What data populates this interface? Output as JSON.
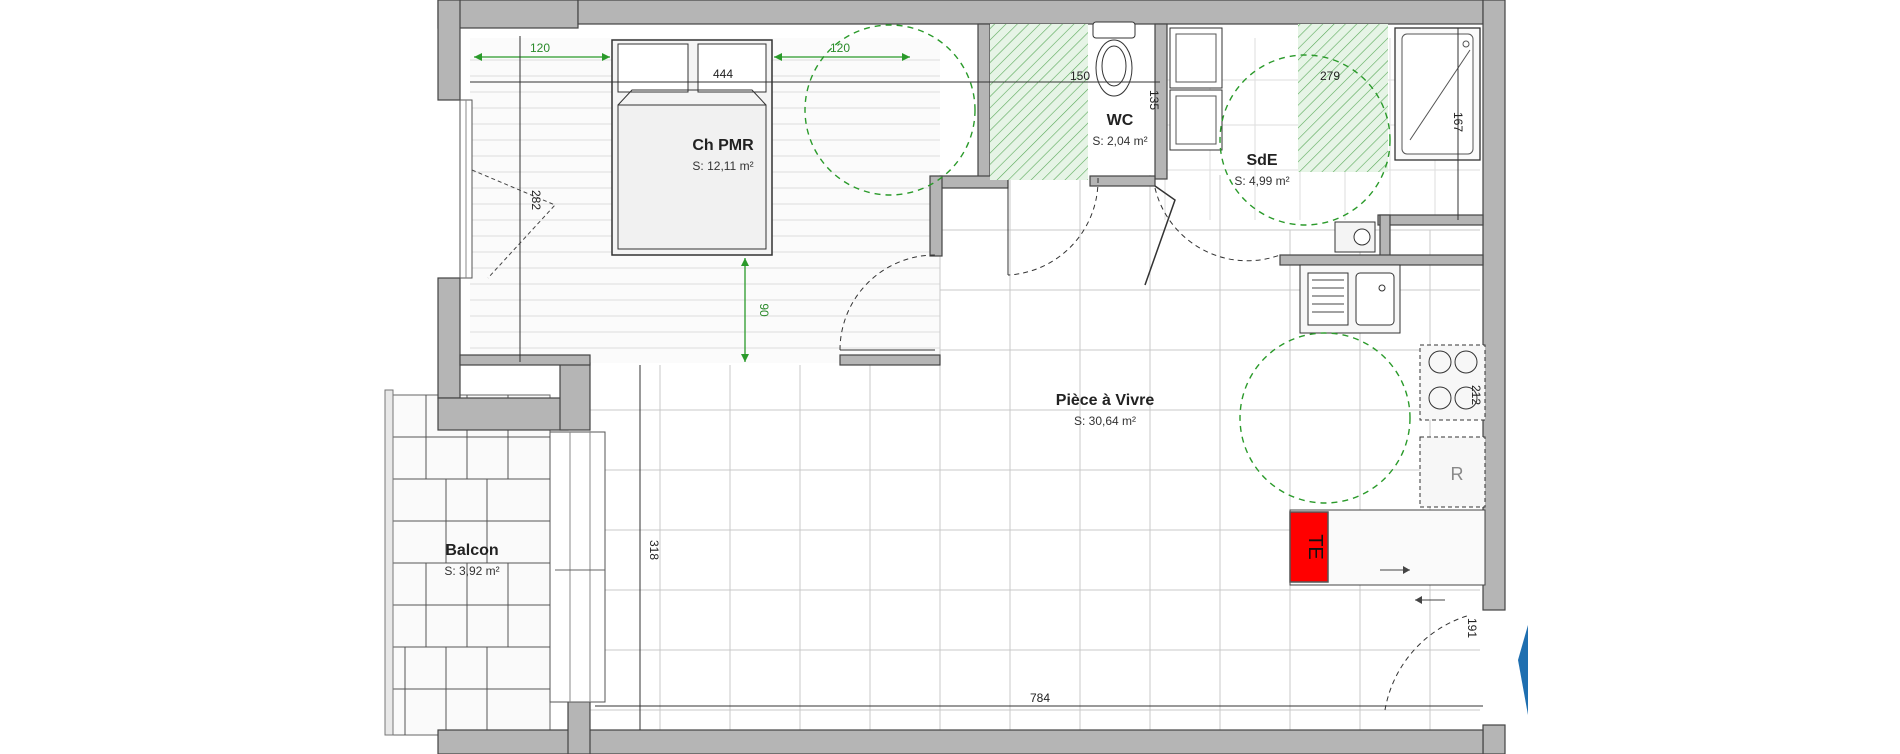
{
  "rooms": {
    "bedroom": {
      "name": "Ch PMR",
      "area": "S: 12,11 m²"
    },
    "wc": {
      "name": "WC",
      "area": "S: 2,04 m²"
    },
    "bathroom": {
      "name": "SdE",
      "area": "S: 4,99 m²"
    },
    "living": {
      "name": "Pièce à Vivre",
      "area": "S: 30,64 m²"
    },
    "balcony": {
      "name": "Balcon",
      "area": "S: 3,92 m²"
    }
  },
  "dimensions": {
    "bed_clear_left": "120",
    "bed_clear_right": "120",
    "bed_width": "444",
    "bed_clear_foot": "90",
    "bedroom_depth": "282",
    "wc_width": "150",
    "wc_depth": "135",
    "sde_width": "279",
    "shower_len": "167",
    "kitchen_len": "212",
    "living_depth": "318",
    "total_width": "784",
    "entry_width": "191"
  },
  "equipment": {
    "electric_panel": "TE",
    "fridge": "R"
  },
  "colors": {
    "wall_fill": "#b5b5b5",
    "clearance_green": "#2a9a2a",
    "panel_red": "#ff0000",
    "entry_marker_blue": "#1f6fb0"
  }
}
